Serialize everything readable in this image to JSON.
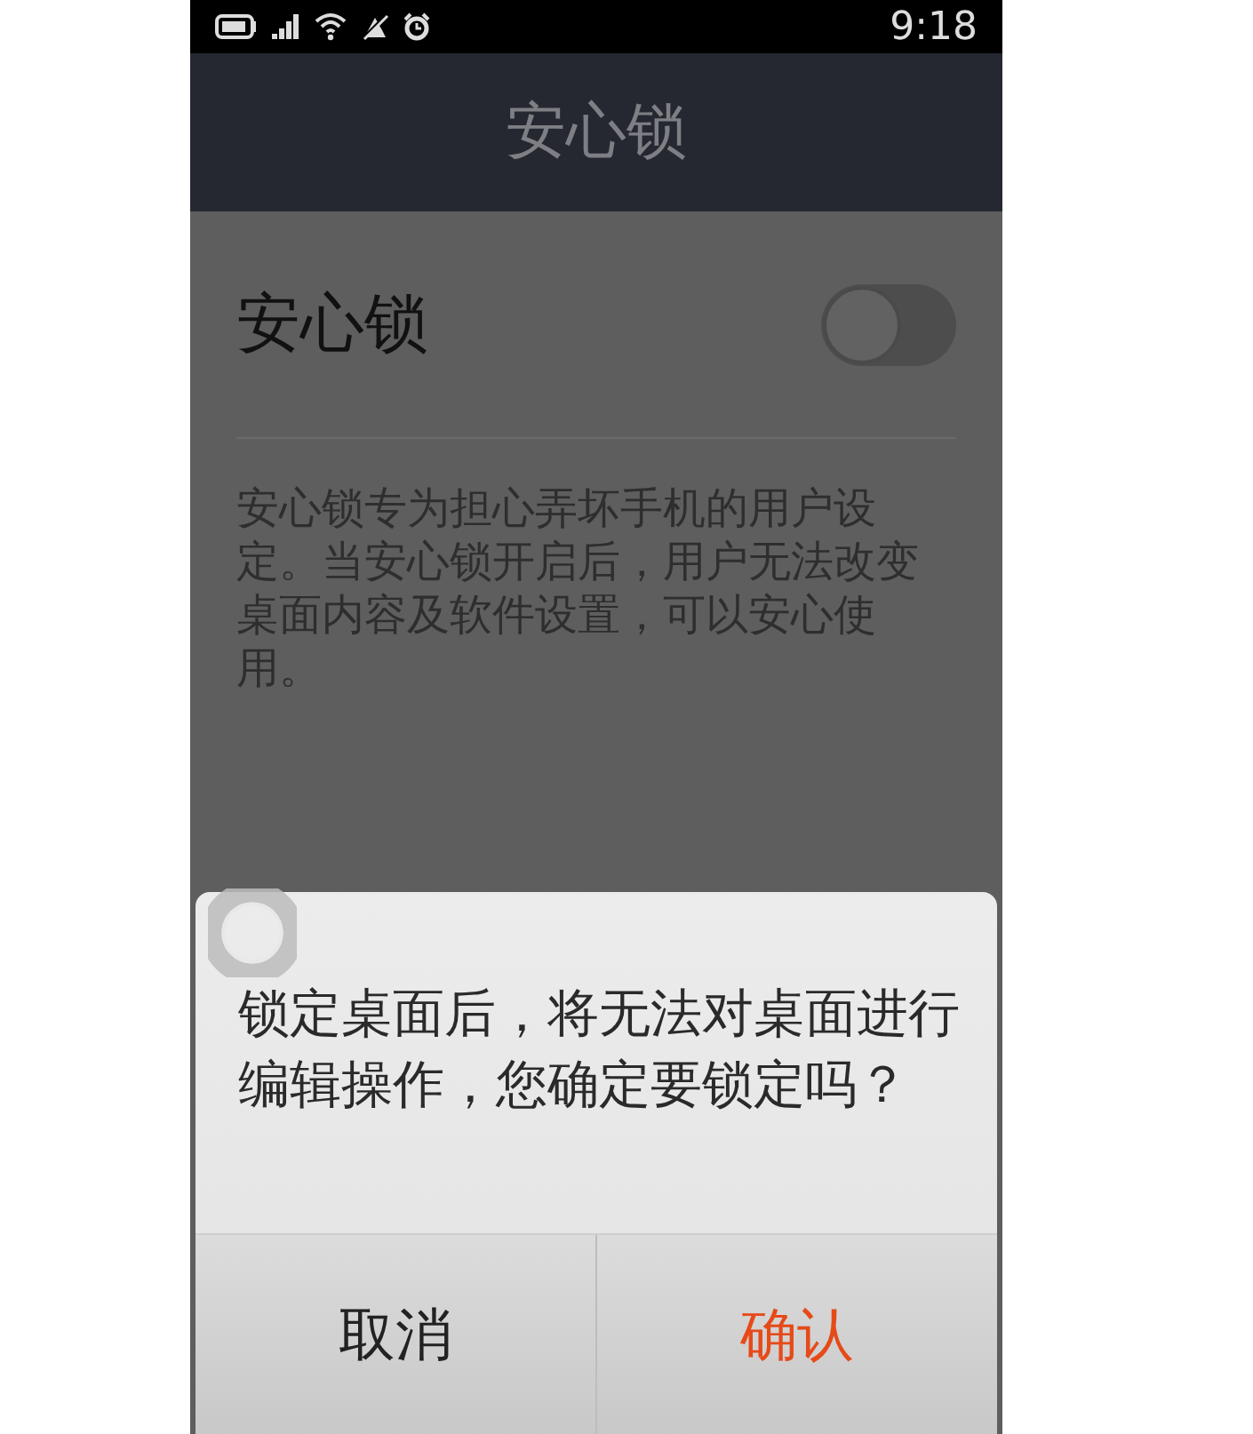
{
  "status_bar": {
    "time": "9:18"
  },
  "title_bar": {
    "title": "安心锁"
  },
  "setting": {
    "label": "安心锁",
    "on": false,
    "description": "安心锁专为担心弄坏手机的用户设定。当安心锁开启后，用户无法改变桌面内容及软件设置，可以安心使用。"
  },
  "dialog": {
    "message": "锁定桌面后，将无法对桌面进行编辑操作，您确定要锁定吗？",
    "buttons": [
      {
        "label": "取消",
        "kind": "cancel"
      },
      {
        "label": "确认",
        "kind": "confirm"
      }
    ]
  }
}
